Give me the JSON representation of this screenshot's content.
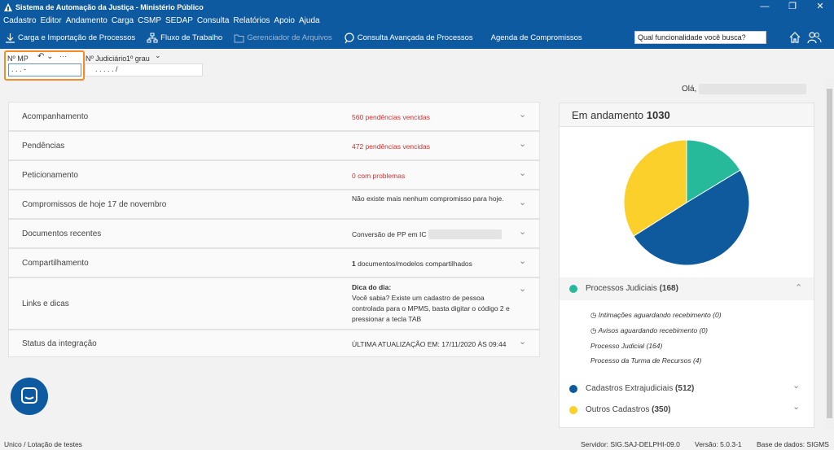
{
  "window": {
    "title": "Sistema de Automação da Justiça - Ministério Público",
    "controls": [
      "—",
      "❐",
      "✕"
    ]
  },
  "menu": [
    "Cadastro",
    "Editor",
    "Andamento",
    "Carga",
    "CSMP",
    "SEDAP",
    "Consulta",
    "Relatórios",
    "Apoio",
    "Ajuda"
  ],
  "toolbar": {
    "carga": "Carga e Importação de Processos",
    "fluxo": "Fluxo de Trabalho",
    "gerenciador": "Gerenciador de Arquivos",
    "consulta": "Consulta Avançada de Processos",
    "agenda": "Agenda de Compromissos",
    "search_value": "Qual funcionalidade você busca?"
  },
  "filter": {
    "mp_label": "Nº MP",
    "mp_value": ". .  .    -",
    "nj_label": "Nº Judiciário",
    "grau_label": "1º grau",
    "nj_value": ". .  .  .  .      /"
  },
  "greeting": "Olá,",
  "rows": [
    {
      "label": "Acompanhamento",
      "count": "560",
      "text": " pendências vencidas"
    },
    {
      "label": "Pendências",
      "count": "472",
      "text": " pendências vencidas"
    },
    {
      "label": "Peticionamento",
      "count": "0",
      "text": " com problemas"
    },
    {
      "label": "Compromissos de hoje 17 de novembro",
      "text": "Não existe mais nenhum compromisso para hoje."
    },
    {
      "label": "Documentos recentes",
      "text": "Conversão de PP em IC"
    },
    {
      "label": "Compartilhamento",
      "count": "1",
      "text": " documentos/modelos compartilhados"
    },
    {
      "label": "Links e dicas",
      "title": "Dica do dia:",
      "text": "Você sabia? Existe um cadastro de pessoa controlada para o MPMS, basta digitar o código 2 e pressionar a tecla TAB"
    },
    {
      "label": "Status da integração",
      "text": "ÚLTIMA ATUALIZAÇÃO EM: 17/11/2020 ÀS 09:44"
    }
  ],
  "side": {
    "title": "Em andamento",
    "total": "1030",
    "colors": {
      "teal": "#26b99a",
      "blue": "#0f5a9c",
      "yellow": "#fbd02a"
    },
    "groups": [
      {
        "name": "Processos Judiciais",
        "count": "(168)",
        "value": 168
      },
      {
        "name": "Cadastros Extrajudiciais",
        "count": "(512)",
        "value": 512
      },
      {
        "name": "Outros Cadastros",
        "count": "(350)",
        "value": 350
      }
    ],
    "subs": [
      "Intimações aguardando recebimento (0)",
      "Avisos aguardando recebimento (0)",
      "Processo Judicial (164)",
      "Processo da Turma de Recursos (4)"
    ]
  },
  "status": {
    "left": "Unico / Lotação de testes",
    "servidor": "Servidor: SIG.SAJ-DELPHI-09.0",
    "versao": "Versão: 5.0.3-1",
    "base": "Base de dados: SIGMS"
  }
}
